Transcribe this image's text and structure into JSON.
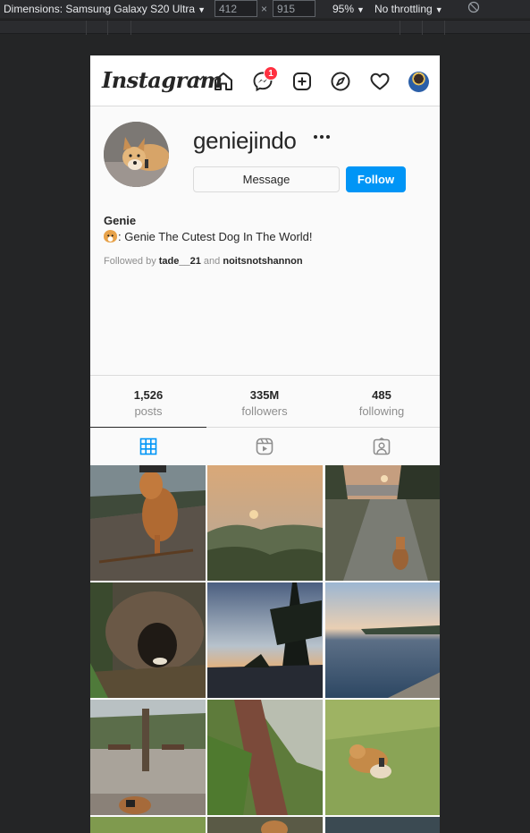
{
  "devtools": {
    "dimensions_label": "Dimensions: Samsung Galaxy S20 Ultra",
    "width": "412",
    "height": "915",
    "zoom": "95%",
    "throttling": "No throttling"
  },
  "header": {
    "logo": "Instagram",
    "messenger_badge": "1"
  },
  "profile": {
    "username": "geniejindo",
    "message_button": "Message",
    "follow_button": "Follow",
    "bio_name": "Genie",
    "bio_text": ": Genie The Cutest Dog In The World!",
    "followed_prefix": "Followed by",
    "followed_user1": "tade__21",
    "followed_and": "and",
    "followed_user2": "noitsnotshannon"
  },
  "stats": [
    {
      "value": "1,526",
      "label": "posts"
    },
    {
      "value": "335M",
      "label": "followers"
    },
    {
      "value": "485",
      "label": "following"
    }
  ],
  "tabs": [
    {
      "icon": "grid-icon",
      "active": true
    },
    {
      "icon": "reels-icon",
      "active": false
    },
    {
      "icon": "tagged-icon",
      "active": false
    }
  ],
  "colors": {
    "follow_blue": "#0095f6",
    "badge_red": "#ff3040",
    "text": "#262626",
    "muted": "#8e8e8e"
  }
}
